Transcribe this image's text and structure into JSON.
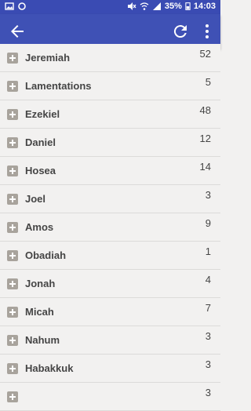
{
  "status_bar": {
    "battery": "35%",
    "time": "14:03"
  },
  "icons": {
    "back": "arrow-left-icon",
    "refresh": "refresh-icon",
    "more": "more-vert-icon",
    "expand": "plus-box-icon"
  },
  "colors": {
    "app_bar": "#3f51b5",
    "status_bar": "#3a4bb3",
    "background": "#f2f1f0",
    "expand_icon": "#a8a39c"
  },
  "books": [
    {
      "name": "Jeremiah",
      "chapters": "52"
    },
    {
      "name": "Lamentations",
      "chapters": "5"
    },
    {
      "name": "Ezekiel",
      "chapters": "48"
    },
    {
      "name": "Daniel",
      "chapters": "12"
    },
    {
      "name": "Hosea",
      "chapters": "14"
    },
    {
      "name": "Joel",
      "chapters": "3"
    },
    {
      "name": "Amos",
      "chapters": "9"
    },
    {
      "name": "Obadiah",
      "chapters": "1"
    },
    {
      "name": "Jonah",
      "chapters": "4"
    },
    {
      "name": "Micah",
      "chapters": "7"
    },
    {
      "name": "Nahum",
      "chapters": "3"
    },
    {
      "name": "Habakkuk",
      "chapters": "3"
    },
    {
      "name": "",
      "chapters": "3"
    }
  ]
}
